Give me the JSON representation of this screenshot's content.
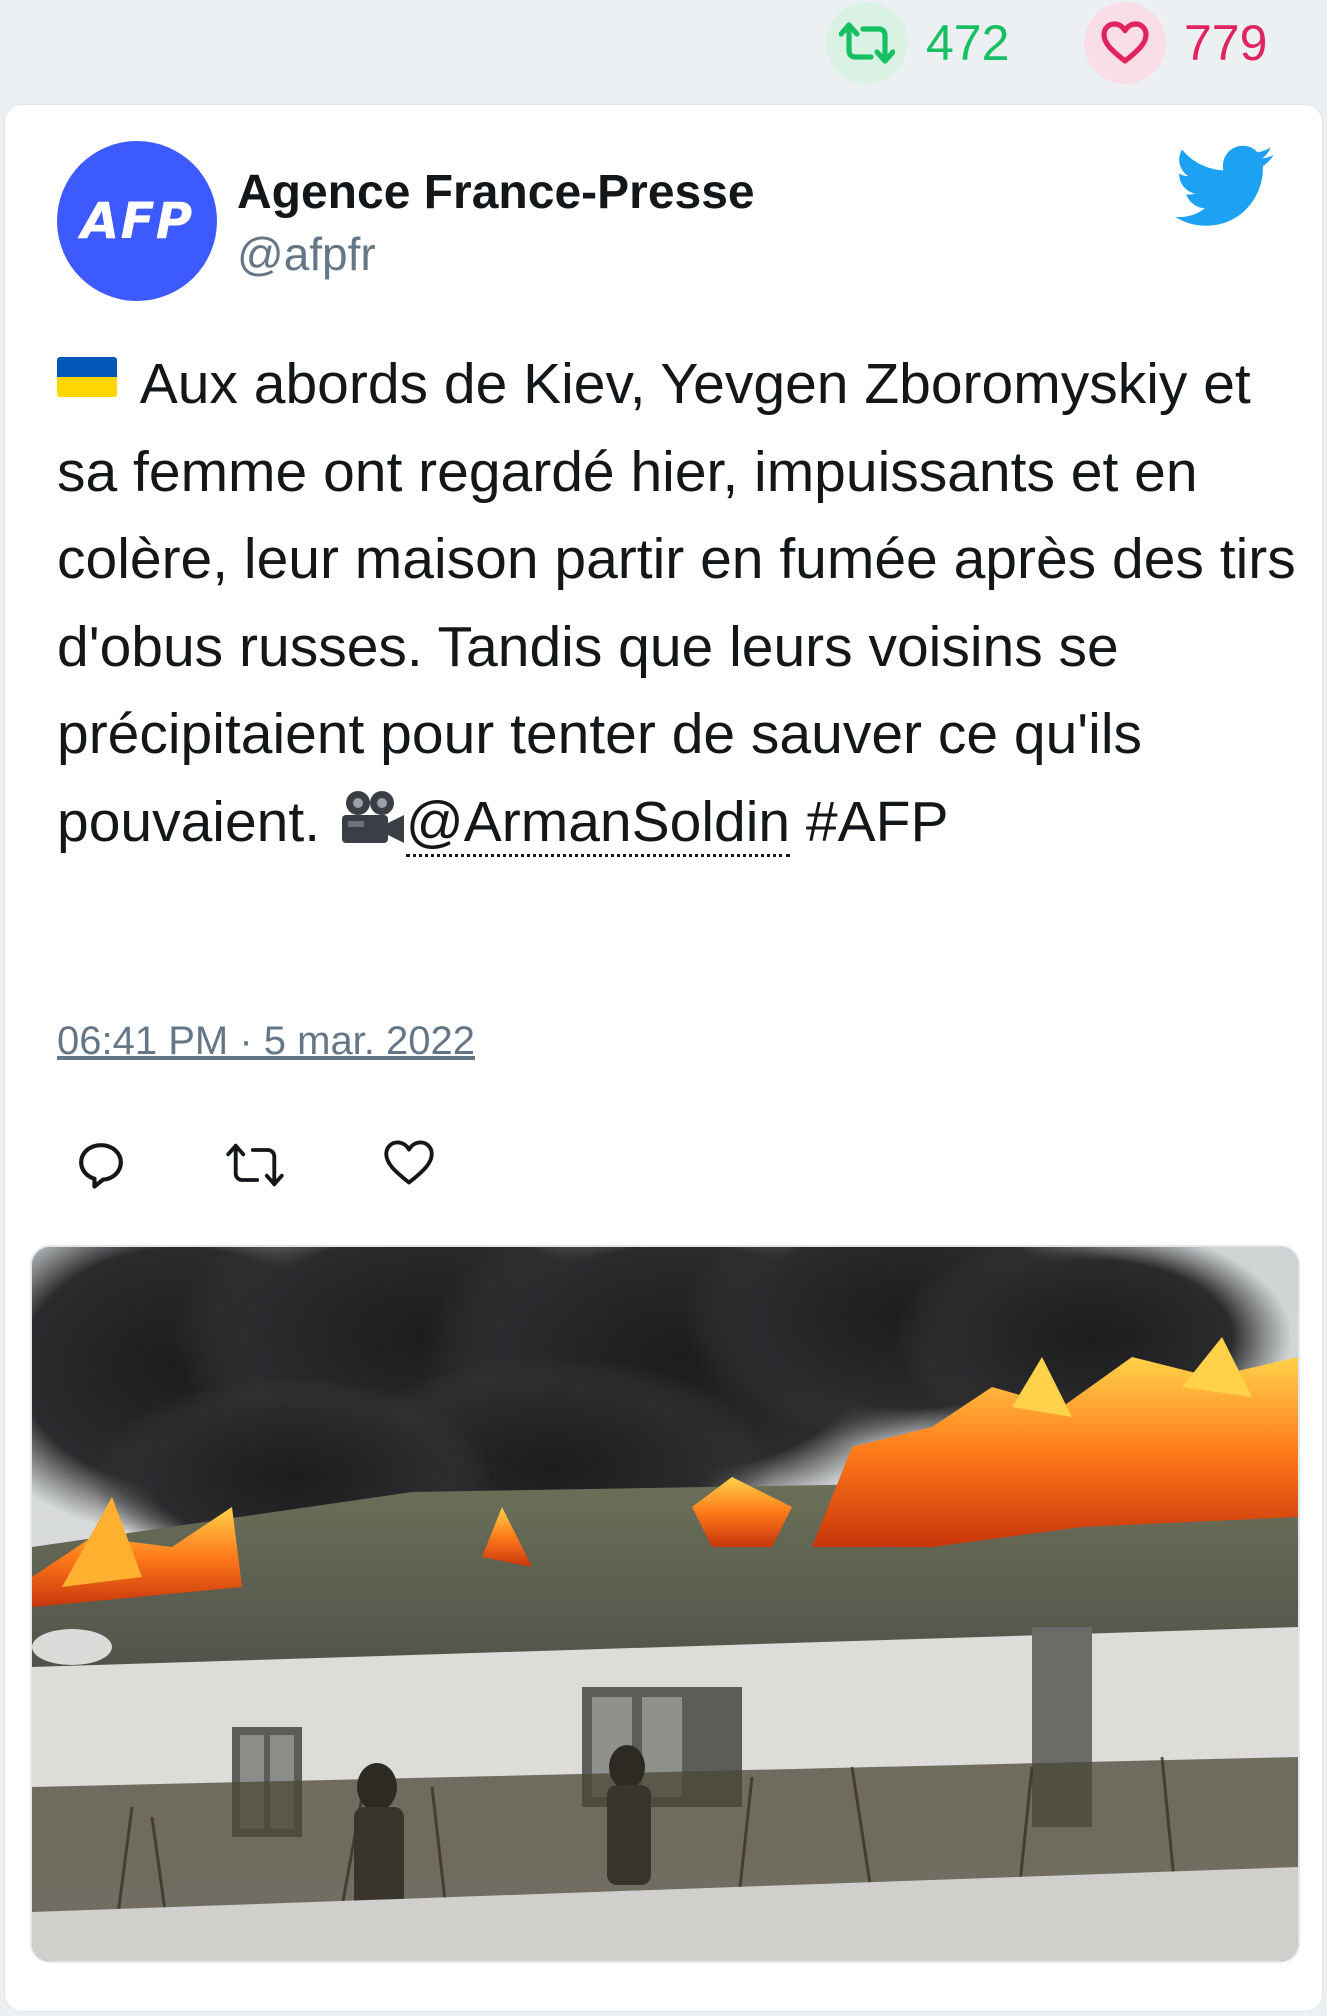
{
  "stats": {
    "retweets": "472",
    "likes": "779",
    "retweet_icon": "retweet-icon",
    "like_icon": "heart-icon",
    "retweet_color": "#17bf63",
    "like_color": "#e0245e"
  },
  "tweet": {
    "author_name": "Agence France-Presse",
    "author_handle": "@afpfr",
    "avatar_text": "AFP",
    "avatar_color": "#3d5afe",
    "text_part1": " Aux abords de Kiev, Yevgen Zboromyskiy et sa femme ont regardé hier, impuissants et en colère, leur maison partir en fumée après des tirs d'obus russes. Tandis que leurs voisins se précipitaient pour tenter de sauver ce qu'ils pouvaient. ",
    "mention": "@ArmanSoldin",
    "hashtag": " #AFP",
    "timestamp": "06:41 PM · 5 mar. 2022",
    "brand_icon": "twitter-bird-icon",
    "brand_color": "#1da1f2"
  },
  "actions": [
    "reply-icon",
    "retweet-icon",
    "like-icon"
  ]
}
